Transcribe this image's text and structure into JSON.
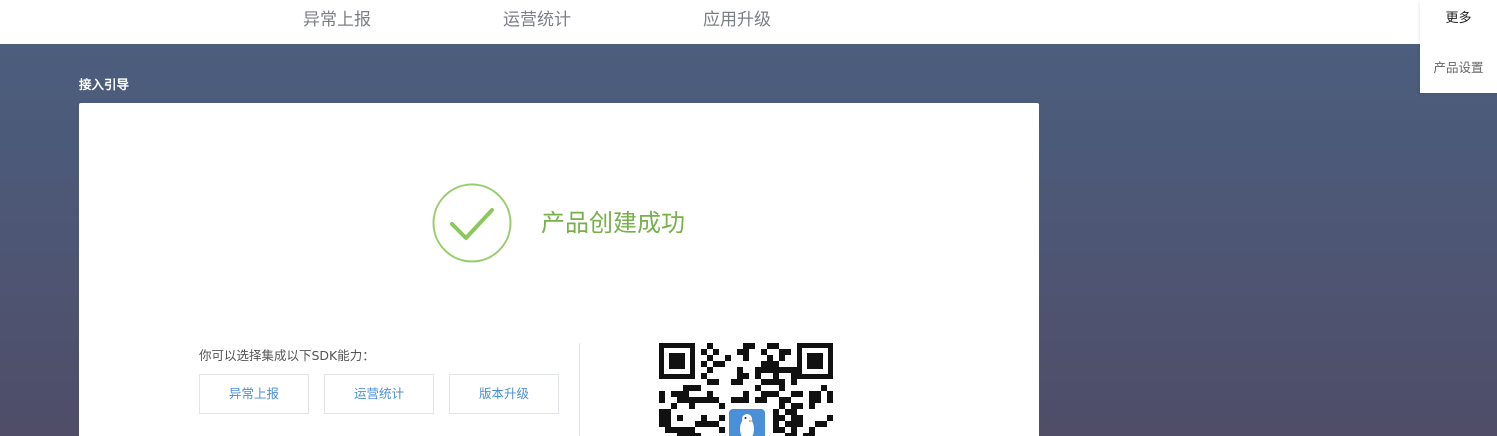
{
  "nav": {
    "items": [
      {
        "label": "异常上报"
      },
      {
        "label": "运营统计"
      },
      {
        "label": "应用升级"
      }
    ]
  },
  "more_menu": {
    "title": "更多",
    "items": [
      {
        "label": "产品设置"
      }
    ]
  },
  "section": {
    "title": "接入引导"
  },
  "success": {
    "message": "产品创建成功",
    "color": "#77b04a"
  },
  "sdk": {
    "prompt": "你可以选择集成以下SDK能力：",
    "buttons": [
      {
        "label": "异常上报"
      },
      {
        "label": "运营统计"
      },
      {
        "label": "版本升级"
      }
    ]
  },
  "qr": {
    "icon": "qr-code-icon",
    "logo": "penguin-logo-icon"
  },
  "colors": {
    "accent": "#4a90d9",
    "success": "#77b04a"
  }
}
